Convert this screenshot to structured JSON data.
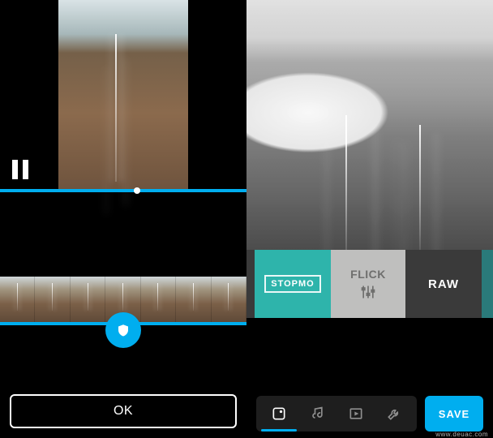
{
  "left_screen": {
    "playback_state": "paused",
    "ok_label": "OK",
    "filmstrip_frames": 7,
    "accent_color": "#00aeef"
  },
  "right_screen": {
    "preview_effect": "black-and-white",
    "filters": {
      "prev_sliver": "",
      "stopmo": "STOPMO",
      "flick": "FLICK",
      "raw": "RAW",
      "next_sliver": ""
    },
    "nav": {
      "effects": "effects-icon",
      "music": "music-icon",
      "fullscreen": "fullscreen-icon",
      "tools": "wrench-icon"
    },
    "save_label": "SAVE",
    "accent_color": "#00aeef"
  },
  "watermark": "www.deuac.com"
}
